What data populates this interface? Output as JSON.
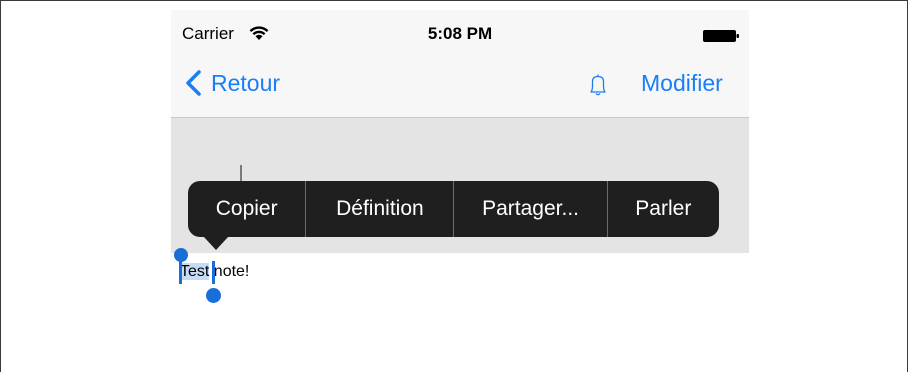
{
  "status_bar": {
    "carrier": "Carrier",
    "time": "5:08 PM",
    "icons": [
      "wifi-icon",
      "battery-icon"
    ]
  },
  "nav": {
    "back_label": "Retour",
    "back_icon": "chevron-left-icon",
    "bell_icon": "bell-icon",
    "edit_label": "Modifier",
    "accent": "#1a7ef7"
  },
  "context_menu": {
    "items": [
      "Copier",
      "Définition",
      "Partager...",
      "Parler"
    ]
  },
  "note": {
    "selected_text": "Test",
    "rest_text": " note!",
    "selection_color": "#c6dbf5",
    "handle_color": "#1a6ed8"
  }
}
